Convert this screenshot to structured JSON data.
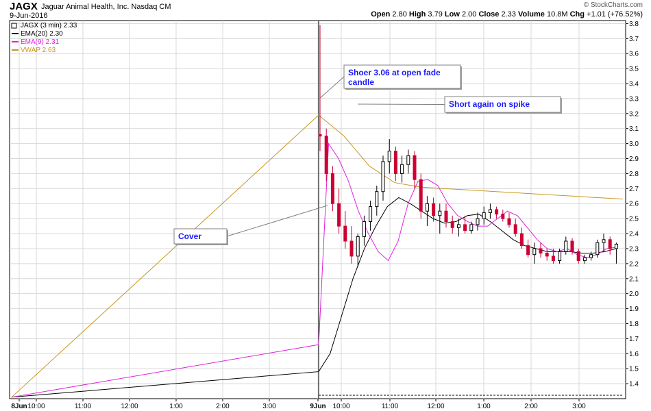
{
  "header": {
    "ticker": "JAGX",
    "company": "Jaguar Animal Health, Inc.  Nasdaq CM",
    "date": "9-Jun-2016",
    "credit": "© StockCharts.com",
    "open_label": "Open",
    "open": "2.80",
    "high_label": "High",
    "high": "3.79",
    "low_label": "Low",
    "low": "2.00",
    "close_label": "Close",
    "close": "2.33",
    "volume_label": "Volume",
    "volume": "10.8M",
    "chg_label": "Chg",
    "chg": "+1.01 (+76.52%)"
  },
  "legend": [
    {
      "label": "JAGX (3 min) 2.33",
      "color": "#000000"
    },
    {
      "label": "EMA(20) 2.30",
      "color": "#000000"
    },
    {
      "label": "EMA(9) 2.31",
      "color": "#e020e0"
    },
    {
      "label": "VWAP 2.63",
      "color": "#c8961e"
    }
  ],
  "annotations": [
    {
      "text": "Shoer 3.06 at open fade",
      "text2": "candle"
    },
    {
      "text": "Short again on spike",
      "text2": ""
    },
    {
      "text": "Cover",
      "text2": ""
    }
  ],
  "chart_data": {
    "type": "candlestick",
    "y_ticks": [
      "1.4",
      "1.5",
      "1.6",
      "1.7",
      "1.8",
      "1.9",
      "2.0",
      "2.1",
      "2.2",
      "2.3",
      "2.4",
      "2.5",
      "2.6",
      "2.7",
      "2.8",
      "2.9",
      "3.0",
      "3.1",
      "3.2",
      "3.3",
      "3.4",
      "3.5",
      "3.6",
      "3.7",
      "3.8"
    ],
    "x_ticks": [
      "8Jun",
      "10:00",
      "11:00",
      "12:00",
      "1:00",
      "2:00",
      "3:00",
      "9Jun",
      "10:00",
      "11:00",
      "12:00",
      "1:00",
      "2:00",
      "3:00"
    ],
    "ylim": [
      1.3,
      3.82
    ],
    "grid": true,
    "legend_position": "top-left",
    "colors": {
      "up": "#000000",
      "down": "#cc0033",
      "ema9": "#e020e0",
      "ema20": "#000000",
      "vwap": "#c8961e"
    },
    "candles": [
      [
        3.06,
        3.79,
        2.95,
        3.05
      ],
      [
        3.05,
        3.1,
        2.75,
        2.8
      ],
      [
        2.8,
        2.85,
        2.55,
        2.6
      ],
      [
        2.6,
        2.7,
        2.4,
        2.45
      ],
      [
        2.45,
        2.55,
        2.3,
        2.35
      ],
      [
        2.35,
        2.45,
        2.2,
        2.25
      ],
      [
        2.25,
        2.4,
        2.18,
        2.38
      ],
      [
        2.38,
        2.52,
        2.32,
        2.48
      ],
      [
        2.48,
        2.62,
        2.42,
        2.58
      ],
      [
        2.58,
        2.72,
        2.52,
        2.68
      ],
      [
        2.68,
        2.92,
        2.62,
        2.88
      ],
      [
        2.88,
        3.03,
        2.8,
        2.95
      ],
      [
        2.95,
        2.98,
        2.75,
        2.8
      ],
      [
        2.8,
        2.92,
        2.74,
        2.86
      ],
      [
        2.86,
        2.96,
        2.8,
        2.92
      ],
      [
        2.92,
        2.95,
        2.7,
        2.76
      ],
      [
        2.76,
        2.8,
        2.5,
        2.55
      ],
      [
        2.55,
        2.65,
        2.45,
        2.6
      ],
      [
        2.6,
        2.64,
        2.48,
        2.52
      ],
      [
        2.52,
        2.6,
        2.4,
        2.55
      ],
      [
        2.55,
        2.6,
        2.44,
        2.48
      ],
      [
        2.48,
        2.52,
        2.4,
        2.44
      ],
      [
        2.44,
        2.5,
        2.38,
        2.46
      ],
      [
        2.46,
        2.52,
        2.4,
        2.42
      ],
      [
        2.42,
        2.48,
        2.4,
        2.46
      ],
      [
        2.46,
        2.54,
        2.42,
        2.5
      ],
      [
        2.5,
        2.58,
        2.46,
        2.54
      ],
      [
        2.54,
        2.6,
        2.5,
        2.56
      ],
      [
        2.56,
        2.58,
        2.5,
        2.53
      ],
      [
        2.53,
        2.56,
        2.48,
        2.5
      ],
      [
        2.5,
        2.54,
        2.44,
        2.46
      ],
      [
        2.46,
        2.5,
        2.38,
        2.4
      ],
      [
        2.4,
        2.44,
        2.3,
        2.32
      ],
      [
        2.32,
        2.36,
        2.24,
        2.26
      ],
      [
        2.26,
        2.34,
        2.2,
        2.3
      ],
      [
        2.3,
        2.34,
        2.24,
        2.27
      ],
      [
        2.27,
        2.3,
        2.22,
        2.25
      ],
      [
        2.25,
        2.3,
        2.2,
        2.22
      ],
      [
        2.22,
        2.3,
        2.2,
        2.28
      ],
      [
        2.28,
        2.38,
        2.26,
        2.35
      ],
      [
        2.35,
        2.37,
        2.26,
        2.28
      ],
      [
        2.28,
        2.3,
        2.2,
        2.22
      ],
      [
        2.22,
        2.26,
        2.2,
        2.24
      ],
      [
        2.24,
        2.28,
        2.22,
        2.26
      ],
      [
        2.26,
        2.36,
        2.24,
        2.34
      ],
      [
        2.34,
        2.4,
        2.28,
        2.36
      ],
      [
        2.36,
        2.38,
        2.26,
        2.3
      ],
      [
        2.3,
        2.34,
        2.2,
        2.33
      ]
    ],
    "ema9": [
      1.31,
      1.66,
      3.0,
      2.9,
      2.75,
      2.55,
      2.4,
      2.28,
      2.22,
      2.35,
      2.6,
      2.75,
      2.76,
      2.72,
      2.6,
      2.52,
      2.48,
      2.45,
      2.45,
      2.5,
      2.55,
      2.52,
      2.44,
      2.36,
      2.3,
      2.28,
      2.3,
      2.26,
      2.24,
      2.26,
      2.3,
      2.31
    ],
    "ema20": [
      1.31,
      1.48,
      1.6,
      1.85,
      2.1,
      2.3,
      2.45,
      2.58,
      2.64,
      2.6,
      2.55,
      2.5,
      2.47,
      2.48,
      2.52,
      2.53,
      2.48,
      2.42,
      2.36,
      2.32,
      2.3,
      2.28,
      2.28,
      2.28,
      2.27,
      2.27,
      2.28,
      2.3
    ],
    "vwap": [
      1.31,
      3.19,
      3.05,
      2.85,
      2.74,
      2.71,
      2.7,
      2.69,
      2.68,
      2.67,
      2.66,
      2.65,
      2.64,
      2.63
    ]
  }
}
